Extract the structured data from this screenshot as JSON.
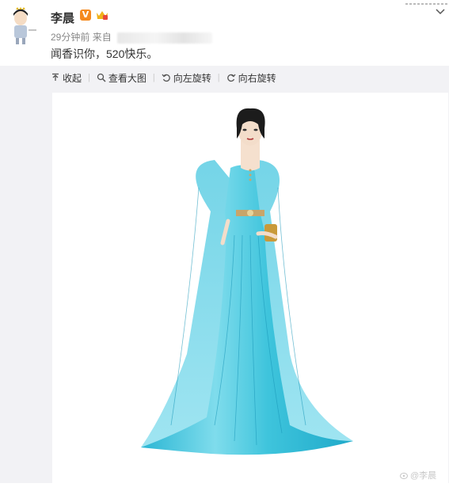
{
  "post": {
    "username": "李晨",
    "verified_badge": "V",
    "time": "29分钟前",
    "source_prefix": "来自",
    "text": "闻香识你，520快乐。"
  },
  "toolbar": {
    "collapse": "收起",
    "view_large": "查看大图",
    "rotate_left": "向左旋转",
    "rotate_right": "向右旋转"
  },
  "image": {
    "watermark": "@李晨",
    "subject": "fashion illustration of a woman in a turquoise cape gown"
  },
  "colors": {
    "accent_badge": "#f58a1f",
    "gown": "#3fc3dc",
    "panel_bg": "#f2f2f5"
  }
}
